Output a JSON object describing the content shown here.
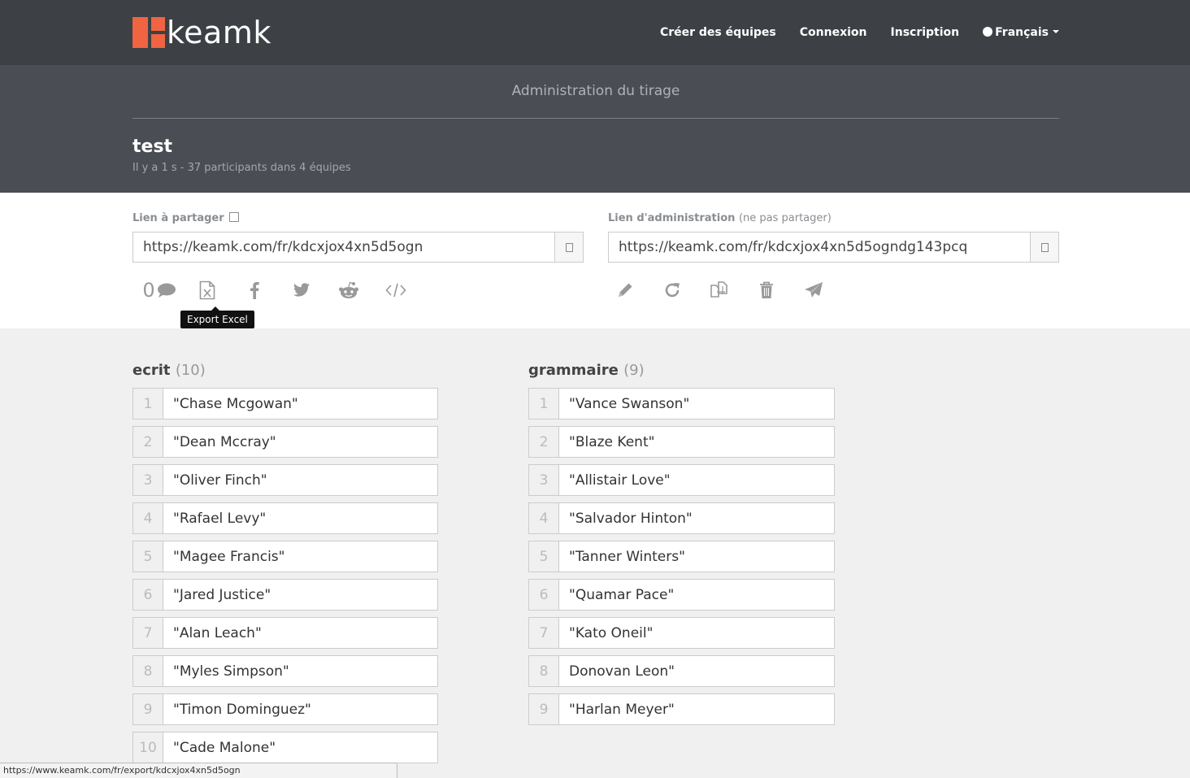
{
  "nav": {
    "logo_text": "keamk",
    "links": [
      "Créer des équipes",
      "Connexion",
      "Inscription"
    ],
    "language": "Français"
  },
  "hero": {
    "title": "Administration du tirage",
    "draw_name": "test",
    "draw_meta": "Il y a 1 s - 37 participants dans 4 équipes"
  },
  "share": {
    "label": "Lien à partager",
    "url": "https://keamk.com/fr/kdcxjox4xn5d5ogn",
    "comment_count": "0"
  },
  "admin": {
    "label": "Lien d'administration",
    "label_note": "(ne pas partager)",
    "url": "https://keamk.com/fr/kdcxjox4xn5d5ogndg143pcq"
  },
  "tooltip": "Export Excel",
  "teams": [
    {
      "name": "ecrit",
      "count": "(10)",
      "members": [
        "\"Chase Mcgowan\"",
        "\"Dean Mccray\"",
        "\"Oliver Finch\"",
        "\"Rafael Levy\"",
        "\"Magee Francis\"",
        "\"Jared Justice\"",
        "\"Alan Leach\"",
        "\"Myles Simpson\"",
        "\"Timon Dominguez\"",
        "\"Cade Malone\""
      ]
    },
    {
      "name": "grammaire",
      "count": "(9)",
      "members": [
        "\"Vance Swanson\"",
        "\"Blaze Kent\"",
        "\"Allistair Love\"",
        "\"Salvador Hinton\"",
        "\"Tanner Winters\"",
        "\"Quamar Pace\"",
        "\"Kato Oneil\"",
        "Donovan Leon\"",
        "\"Harlan Meyer\""
      ]
    }
  ],
  "status_url": "https://www.keamk.com/fr/export/kdcxjox4xn5d5ogn"
}
